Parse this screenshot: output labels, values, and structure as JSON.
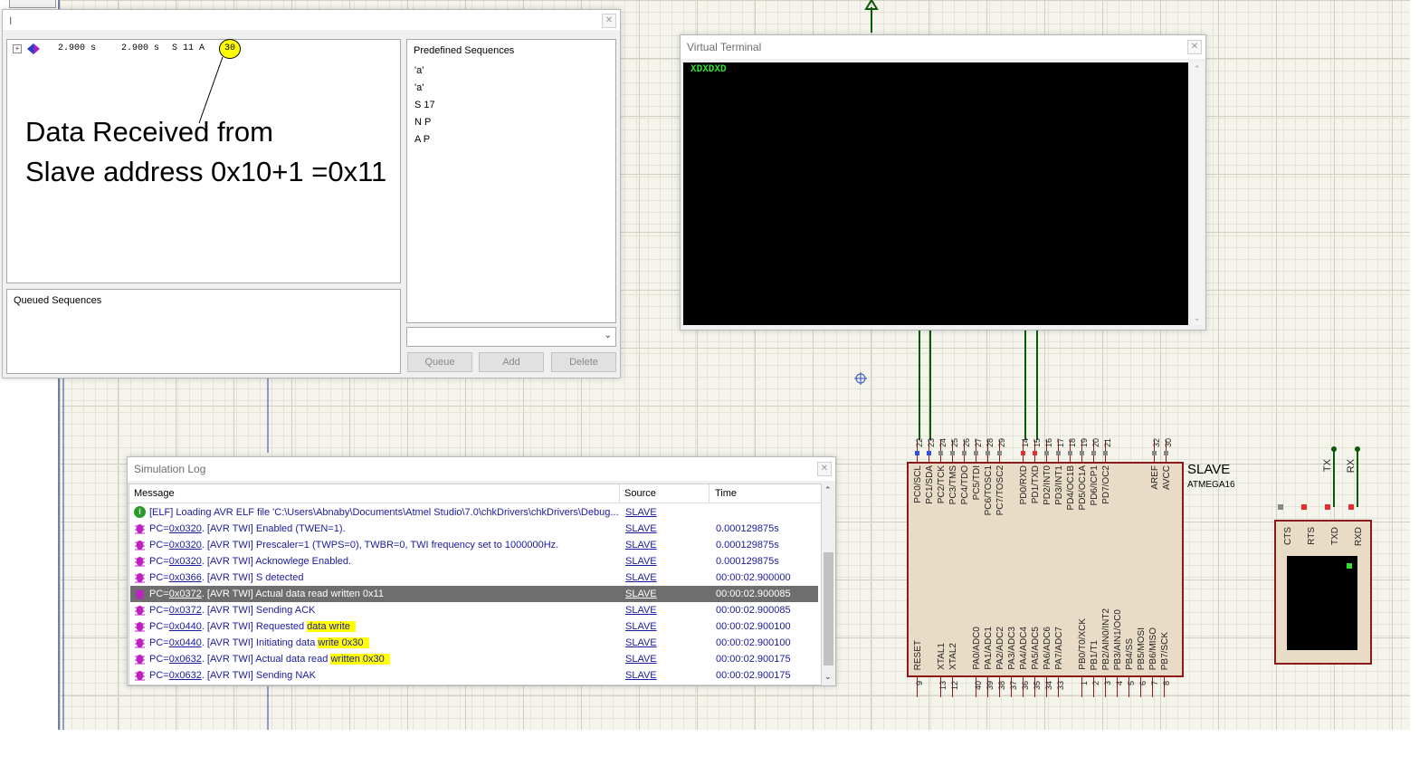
{
  "i2c_debugger": {
    "title": "I",
    "trace": {
      "t1": "2.900 s",
      "t2": "2.900 s",
      "seq": "S 11 A",
      "data_byte": "30"
    },
    "annotation_line1": "Data Received from",
    "annotation_line2": "Slave address 0x10+1 =0x11",
    "predefined_header": "Predefined Sequences",
    "predefined": [
      "'a'",
      "'a'",
      "S 17",
      "N P",
      "A P"
    ],
    "queued_header": "Queued Sequences",
    "buttons": {
      "queue": "Queue",
      "add": "Add",
      "delete": "Delete"
    }
  },
  "terminal": {
    "title": "Virtual Terminal",
    "output": "XDXDXD"
  },
  "sim_log": {
    "title": "Simulation Log",
    "columns": {
      "message": "Message",
      "source": "Source",
      "time": "Time"
    },
    "rows": [
      {
        "icon": "info",
        "pc": "",
        "text": "[ELF] Loading AVR ELF file 'C:\\Users\\Abnaby\\Documents\\Atmel Studio\\7.0\\chkDrivers\\chkDrivers\\Debug...",
        "source": "SLAVE",
        "time": ""
      },
      {
        "icon": "bug",
        "pc": "0x0320",
        "text": ". [AVR TWI] Enabled (TWEN=1).",
        "source": "SLAVE",
        "time": "0.000129875s"
      },
      {
        "icon": "bug",
        "pc": "0x0320",
        "text": ". [AVR TWI] Prescaler=1 (TWPS=0), TWBR=0, TWI frequency set to 1000000Hz.",
        "source": "SLAVE",
        "time": "0.000129875s"
      },
      {
        "icon": "bug",
        "pc": "0x0320",
        "text": ". [AVR TWI] Acknowlege Enabled.",
        "source": "SLAVE",
        "time": "0.000129875s"
      },
      {
        "icon": "bug",
        "pc": "0x0366",
        "text": ". [AVR TWI] S detected",
        "source": "SLAVE",
        "time": "00:00:02.900000"
      },
      {
        "icon": "bug",
        "pc": "0x0372",
        "text": ". [AVR TWI] Actual data read written 0x11",
        "source": "SLAVE",
        "time": "00:00:02.900085",
        "selected": true
      },
      {
        "icon": "bug",
        "pc": "0x0372",
        "text": ". [AVR TWI] Sending ACK",
        "source": "SLAVE",
        "time": "00:00:02.900085"
      },
      {
        "icon": "bug",
        "pc": "0x0440",
        "text": ". [AVR TWI] Requested data write",
        "source": "SLAVE",
        "time": "00:00:02.900100",
        "highlight": "data write"
      },
      {
        "icon": "bug",
        "pc": "0x0440",
        "text": ". [AVR TWI] Initiating data write 0x30",
        "source": "SLAVE",
        "time": "00:00:02.900100",
        "highlight": "write 0x30"
      },
      {
        "icon": "bug",
        "pc": "0x0632",
        "text": ". [AVR TWI] Actual data read written 0x30",
        "source": "SLAVE",
        "time": "00:00:02.900175",
        "highlight": "written 0x30"
      },
      {
        "icon": "bug",
        "pc": "0x0632",
        "text": ". [AVR TWI] Sending NAK",
        "source": "SLAVE",
        "time": "00:00:02.900175"
      }
    ]
  },
  "chip": {
    "name": "SLAVE",
    "part": "ATMEGA16",
    "top_pins": [
      {
        "n": "22",
        "l": "PC0/SCL"
      },
      {
        "n": "23",
        "l": "PC1/SDA"
      },
      {
        "n": "24",
        "l": "PC2/TCK"
      },
      {
        "n": "25",
        "l": "PC3/TMS"
      },
      {
        "n": "26",
        "l": "PC4/TDO"
      },
      {
        "n": "27",
        "l": "PC5/TDI"
      },
      {
        "n": "28",
        "l": "PC6/TOSC1"
      },
      {
        "n": "29",
        "l": "PC7/TOSC2"
      },
      {
        "n": "14",
        "l": "PD0/RXD"
      },
      {
        "n": "15",
        "l": "PD1/TXD"
      },
      {
        "n": "16",
        "l": "PD2/INT0"
      },
      {
        "n": "17",
        "l": "PD3/INT1"
      },
      {
        "n": "18",
        "l": "PD4/OC1B"
      },
      {
        "n": "19",
        "l": "PD5/OC1A"
      },
      {
        "n": "20",
        "l": "PD6/ICP1"
      },
      {
        "n": "21",
        "l": "PD7/OC2"
      },
      {
        "n": "32",
        "l": "AREF"
      },
      {
        "n": "30",
        "l": "AVCC"
      }
    ],
    "bottom_pins": [
      {
        "n": "9",
        "l": "RESET"
      },
      {
        "n": "13",
        "l": "XTAL1"
      },
      {
        "n": "12",
        "l": "XTAL2"
      },
      {
        "n": "40",
        "l": "PA0/ADC0"
      },
      {
        "n": "39",
        "l": "PA1/ADC1"
      },
      {
        "n": "38",
        "l": "PA2/ADC2"
      },
      {
        "n": "37",
        "l": "PA3/ADC3"
      },
      {
        "n": "36",
        "l": "PA4/ADC4"
      },
      {
        "n": "35",
        "l": "PA5/ADC5"
      },
      {
        "n": "34",
        "l": "PA6/ADC6"
      },
      {
        "n": "33",
        "l": "PA7/ADC7"
      },
      {
        "n": "1",
        "l": "PB0/T0/XCK"
      },
      {
        "n": "2",
        "l": "PB1/T1"
      },
      {
        "n": "3",
        "l": "PB2/AIN0/INT2"
      },
      {
        "n": "4",
        "l": "PB3/AIN1/OC0"
      },
      {
        "n": "5",
        "l": "PB4/SS"
      },
      {
        "n": "6",
        "l": "PB5/MOSI"
      },
      {
        "n": "7",
        "l": "PB6/MISO"
      },
      {
        "n": "8",
        "l": "PB7/SCK"
      }
    ]
  },
  "vt_component": {
    "pins": [
      "CTS",
      "RTS",
      "TXD",
      "RXD"
    ],
    "tx": "TX",
    "rx": "RX"
  }
}
